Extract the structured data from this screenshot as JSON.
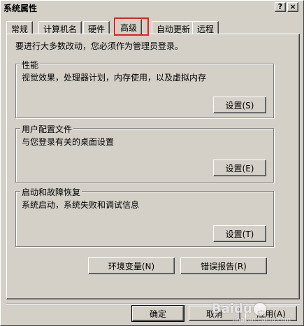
{
  "window": {
    "title": "系统属性",
    "help_btn": "?",
    "close_btn": "×"
  },
  "tabs": [
    {
      "label": "常规"
    },
    {
      "label": "计算机名"
    },
    {
      "label": "硬件"
    },
    {
      "label": "高级"
    },
    {
      "label": "自动更新"
    },
    {
      "label": "远程"
    }
  ],
  "active_tab": "高级",
  "notice": "要进行大多数改动，您必须作为管理员登录。",
  "groups": {
    "performance": {
      "title": "性能",
      "description": "视觉效果，处理器计划，内存使用，以及虚拟内存",
      "button": "设置(S)"
    },
    "profiles": {
      "title": "用户配置文件",
      "description": "与您登录有关的桌面设置",
      "button": "设置(E)"
    },
    "startup": {
      "title": "启动和故障恢复",
      "description": "系统启动，系统失败和调试信息",
      "button": "设置(T)"
    }
  },
  "env_button": "环境变量(N)",
  "error_button": "错误报告(R)",
  "footer": {
    "ok": "确定",
    "cancel": "取消",
    "apply": "应用(A)"
  },
  "watermark": {
    "text": "Baidu",
    "sub": "jingyan.baidu.com"
  },
  "colors": {
    "face": "#d4d0c8",
    "highlight_box": "#e02020"
  }
}
